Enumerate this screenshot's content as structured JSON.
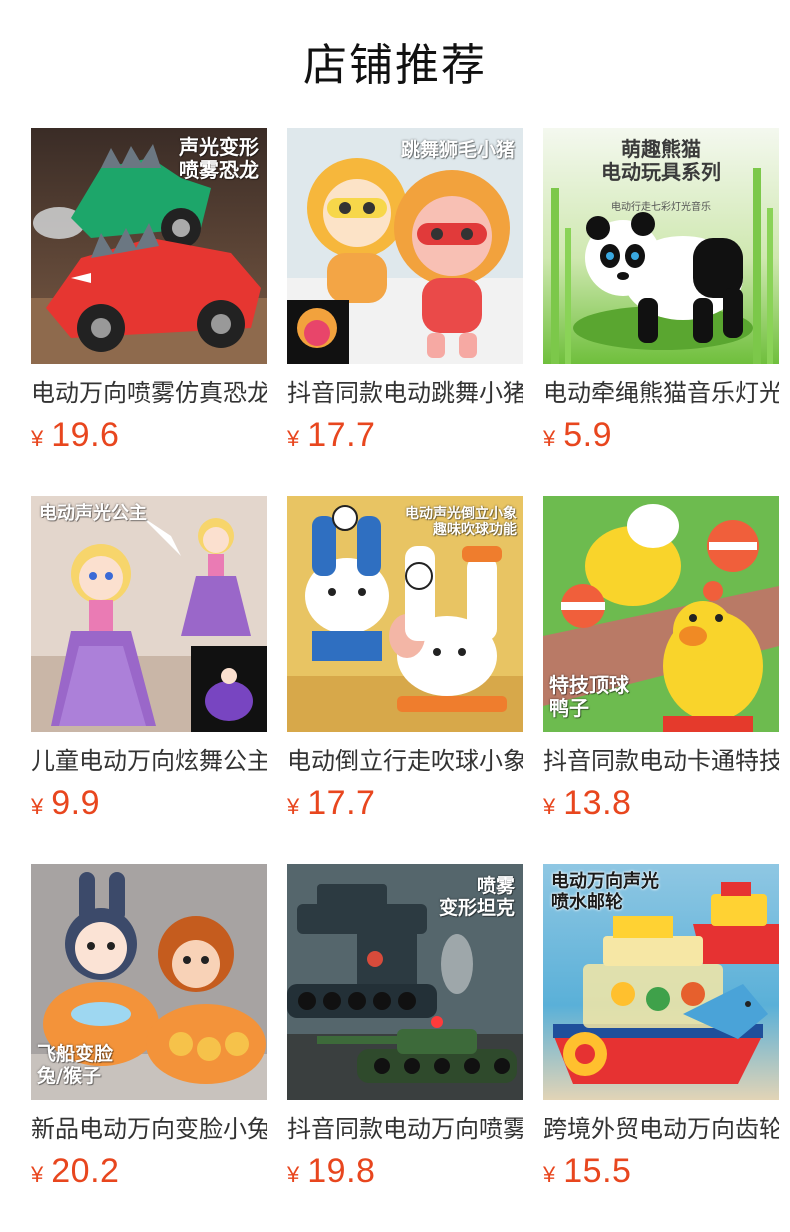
{
  "page": {
    "title": "店铺推荐"
  },
  "colors": {
    "price": "#e8461e",
    "title": "#111111",
    "name": "#333333"
  },
  "products": [
    {
      "name": "电动万向喷雾仿真恐龙变形车",
      "currency": "¥",
      "price": "19.6",
      "overlay": "声光变形\n喷雾恐龙",
      "image": "dinosaur-car-image"
    },
    {
      "name": "抖音同款电动跳舞小猪狮子",
      "currency": "¥",
      "price": "17.7",
      "overlay": "跳舞狮毛小猪",
      "image": "dancing-pig-image"
    },
    {
      "name": "电动牵绳熊猫音乐灯光玩具",
      "currency": "¥",
      "price": "5.9",
      "overlay": "萌趣熊猫\n电动玩具系列",
      "overlay_sub": "电动行走七彩灯光音乐",
      "image": "panda-image"
    },
    {
      "name": "儿童电动万向炫舞公主玩具",
      "currency": "¥",
      "price": "9.9",
      "overlay": "电动声光公主",
      "image": "princess-image"
    },
    {
      "name": "电动倒立行走吹球小象玩具",
      "currency": "¥",
      "price": "17.7",
      "overlay": "电动声光倒立小象\n趣味吹球功能",
      "image": "elephant-image"
    },
    {
      "name": "抖音同款电动卡通特技鸭子",
      "currency": "¥",
      "price": "13.8",
      "overlay": "特技顶球\n鸭子",
      "image": "duck-image"
    },
    {
      "name": "新品电动万向变脸小兔猴子",
      "currency": "¥",
      "price": "20.2",
      "overlay": "飞船变脸\n兔/猴子",
      "image": "rabbit-monkey-image"
    },
    {
      "name": "抖音同款电动万向喷雾坦克",
      "currency": "¥",
      "price": "19.8",
      "overlay": "喷雾\n变形坦克",
      "image": "tank-image"
    },
    {
      "name": "跨境外贸电动万向齿轮邮轮",
      "currency": "¥",
      "price": "15.5",
      "overlay": "电动万向声光\n喷水邮轮",
      "image": "cruise-ship-image"
    }
  ]
}
